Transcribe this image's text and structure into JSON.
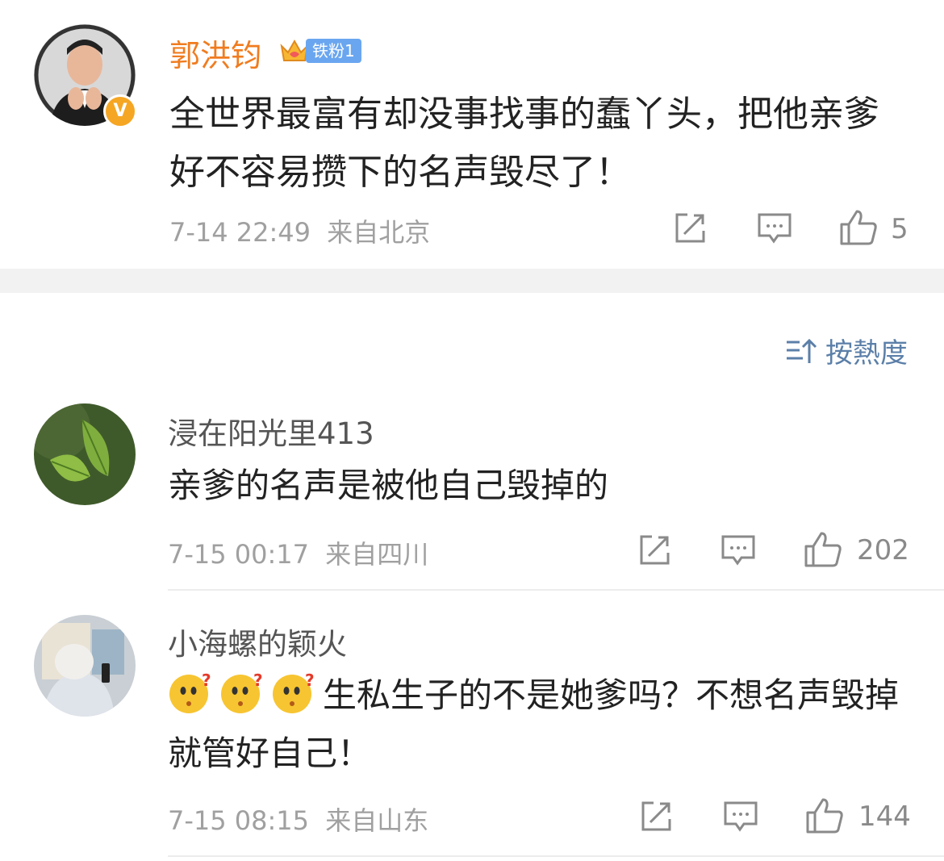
{
  "post": {
    "author": "郭洪钧",
    "fan_badge": "铁粉1",
    "verified_mark": "V",
    "text": "全世界最富有却没事找事的蠢丫头，把他亲爹好不容易攒下的名声毁尽了！",
    "time": "7-14 22:49",
    "location": "来自北京",
    "likes": "5",
    "icons": {
      "share": "share-icon",
      "comment": "comment-icon",
      "like": "thumbs-up-icon"
    }
  },
  "sort": {
    "label": "按熱度",
    "icon": "sort-icon"
  },
  "comments": [
    {
      "name": "浸在阳光里413",
      "text": "亲爹的名声是被他自己毁掉的",
      "time": "7-15 00:17",
      "location": "来自四川",
      "likes": "202"
    },
    {
      "name": "小海螺的颖火",
      "emojis": [
        "confused-emoji",
        "confused-emoji",
        "confused-emoji"
      ],
      "text": "生私生子的不是她爹吗？不想名声毁掉就管好自己！",
      "time": "7-15 08:15",
      "location": "来自山东",
      "likes": "144"
    }
  ],
  "colors": {
    "author_orange": "#f07c1f",
    "badge_blue": "#6aa6f0",
    "sort_blue": "#5b7fa8",
    "verified_gold": "#f5a623"
  }
}
